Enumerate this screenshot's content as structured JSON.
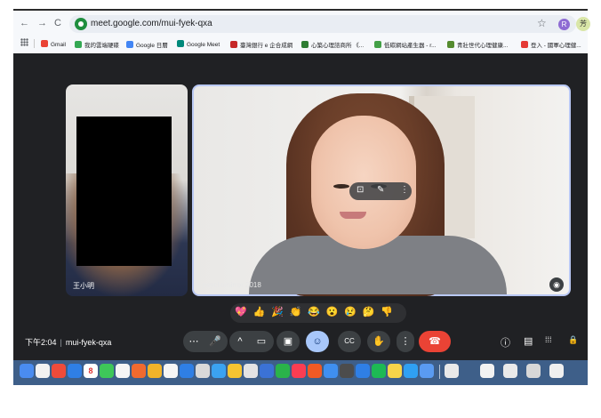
{
  "browser": {
    "url": "meet.google.com/mui-fyek-qxa",
    "profile_letter": "R",
    "edge_avatar": "芳",
    "bookmarks": [
      {
        "label": "Gmail",
        "color": "#ea4335"
      },
      {
        "label": "我的雲端硬碟",
        "color": "#34a853"
      },
      {
        "label": "Google 日曆",
        "color": "#4285f4"
      },
      {
        "label": "Google Meet",
        "color": "#00897b"
      },
      {
        "label": "臺灣銀行 e 企合成網",
        "color": "#c62828"
      },
      {
        "label": "心築心理諮商所 《...",
        "color": "#2e7d32"
      },
      {
        "label": "低碳網站產生器 - r...",
        "color": "#43a047"
      },
      {
        "label": "青壯世代心理健康...",
        "color": "#558b2f"
      },
      {
        "label": "登入 - 國軍心理健...",
        "color": "#e53935"
      }
    ]
  },
  "meeting": {
    "time": "下午2:04",
    "code": "mui-fyek-qxa",
    "left_participant_name": "王小明",
    "main_participant_watermark": "psychtimirror 2018",
    "reactions": [
      "💖",
      "👍",
      "🎉",
      "👏",
      "😂",
      "😮",
      "😢",
      "🤔",
      "👎"
    ]
  },
  "icons": {
    "more_options": "⋯",
    "mic": "🎤",
    "chevron_up": "^",
    "camera": "▭",
    "present": "▣",
    "reaction": "☺",
    "captions": "CC",
    "raise_hand": "✋",
    "more_vert": "⋮",
    "hangup": "☎",
    "info": "ⓘ",
    "chat": "▤",
    "activities": "⁞⁞⁞",
    "host_controls": "🔒"
  },
  "dock_colors": [
    "#4a8cf0",
    "#f2f2f2",
    "#ef4b3a",
    "#2f7fe5",
    "#ffffff",
    "#3ec759",
    "#f5f5f5",
    "#f06a2f",
    "#f0b32a",
    "#f5f5f5",
    "#2f7fe5",
    "#d9d9d9",
    "#3ba2f1",
    "#f6c431",
    "#e3e3e3",
    "#3b72d6",
    "#2ab34a",
    "#fb3d52",
    "#f05a24",
    "#3f8ff0",
    "#4c4c4c",
    "#2f7fe5",
    "#1db954",
    "#f7d54a",
    "#2fa0f3",
    "#5a9bf1",
    "#e9e9e9",
    "#f2f2f2",
    "#eaeaea",
    "#d8d8d8",
    "#efefef"
  ],
  "dock_badge": "8"
}
